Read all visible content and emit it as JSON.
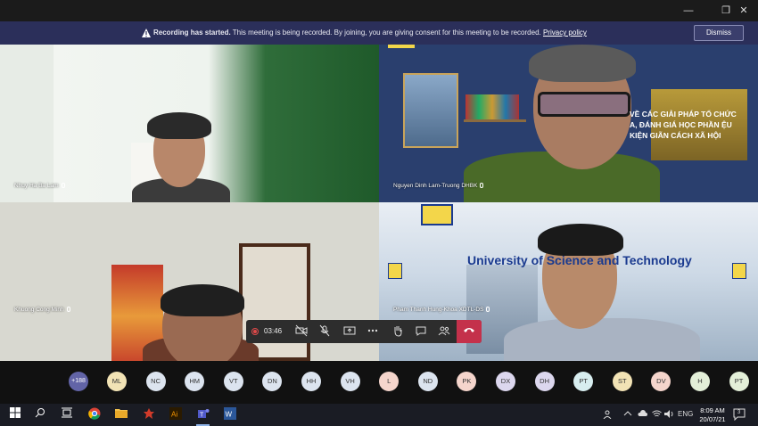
{
  "window": {
    "minimize": "—",
    "maximize": "❐",
    "close": "✕"
  },
  "banner": {
    "bold": "Recording has started.",
    "text": " This meeting is being recorded. By joining, you are giving consent for this meeting to be recorded. ",
    "link": "Privacy policy",
    "dismiss": "Dismiss"
  },
  "tiles": [
    {
      "name": "Nhuy Ha Ba Lam"
    },
    {
      "name": "Nguyen Dinh Lam-Truong DHBK"
    },
    {
      "name": "Khuong Cong Minh"
    },
    {
      "name": "Pham Thanh Hung-Khoa XDTL-DS"
    }
  ],
  "slide": {
    "title": "VỀ CÁC GIẢI PHÁP TỔ CHỨC A, ĐÁNH GIÁ HỌC PHẦN ỆU KIỆN GIÃN CÁCH XÃ HỘI"
  },
  "university_text": "University of Science and Technology",
  "callbar": {
    "timer": "03:46"
  },
  "roster": {
    "more": "+188",
    "people": [
      {
        "initials": "ML",
        "color": "#f2e3b5"
      },
      {
        "initials": "NC",
        "color": "#dce4ef"
      },
      {
        "initials": "HM",
        "color": "#dce4ef"
      },
      {
        "initials": "VT",
        "color": "#dce4ef"
      },
      {
        "initials": "DN",
        "color": "#dce4ef"
      },
      {
        "initials": "HH",
        "color": "#dce4ef"
      },
      {
        "initials": "VH",
        "color": "#dce4ef"
      },
      {
        "initials": "L",
        "color": "#f5d5cc"
      },
      {
        "initials": "ND",
        "color": "#dce4ef"
      },
      {
        "initials": "PK",
        "color": "#f5d5cc"
      },
      {
        "initials": "DX",
        "color": "#dcd7ee"
      },
      {
        "initials": "DH",
        "color": "#dcd7ee"
      },
      {
        "initials": "PT",
        "color": "#d8eef0"
      },
      {
        "initials": "ST",
        "color": "#f2e3b5"
      },
      {
        "initials": "DV",
        "color": "#f5d5cc"
      },
      {
        "initials": "H",
        "color": "#e3efd8"
      },
      {
        "initials": "PT",
        "color": "#e3efd8"
      }
    ]
  },
  "taskbar": {
    "language": "ENG",
    "time": "8:09 AM",
    "date": "20/07/21",
    "notifications": "3"
  }
}
